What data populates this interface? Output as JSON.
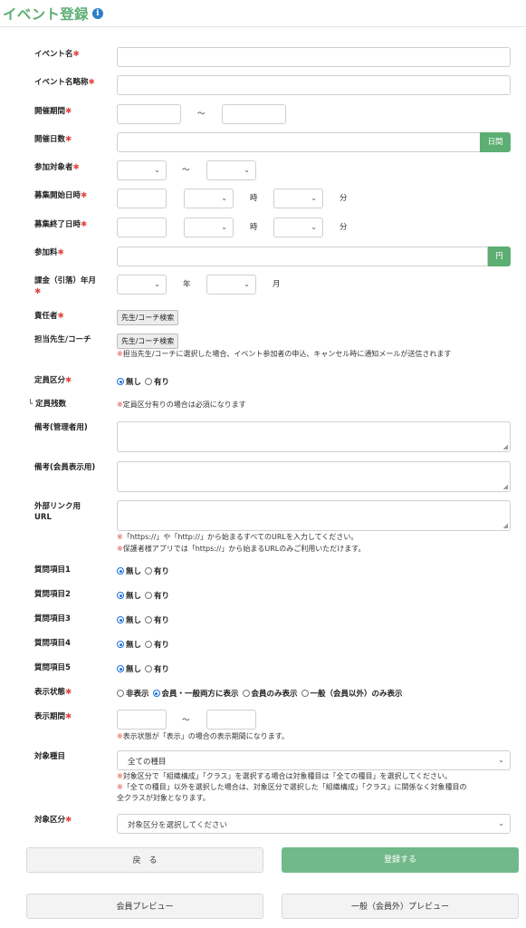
{
  "header": {
    "title": "イベント登録",
    "info_icon": "i"
  },
  "required_mark": "✱",
  "fields": {
    "event_name": "イベント名",
    "event_short": "イベント名略称",
    "period": "開催期間",
    "days": "開催日数",
    "target": "参加対象者",
    "recruit_start": "募集開始日時",
    "recruit_end": "募集終了日時",
    "fee": "参加料",
    "billing": "課金（引落）年月",
    "responsible": "責任者",
    "coach": "担当先生/コーチ",
    "capacity_type": "定員区分",
    "capacity_left": "└ 定員残数",
    "note_admin": "備考(管理者用)",
    "note_member": "備考(会員表示用)",
    "ext_link_1": "外部リンク用",
    "ext_link_2": "URL",
    "q1": "質問項目1",
    "q2": "質問項目2",
    "q3": "質問項目3",
    "q4": "質問項目4",
    "q5": "質問項目5",
    "display_state": "表示状態",
    "display_period": "表示期間",
    "target_type": "対象種目",
    "target_class": "対象区分"
  },
  "units": {
    "tilde": "〜",
    "days_addon": "日間",
    "yen_addon": "円",
    "hour": "時",
    "minute": "分",
    "year": "年",
    "month": "月"
  },
  "buttons": {
    "coach_search_1": "先生/コーチ検索",
    "coach_search_2": "先生/コーチ検索",
    "back": "戻　る",
    "register": "登録する",
    "member_preview": "会員プレビュー",
    "public_preview": "一般（会員外）プレビュー"
  },
  "notes": {
    "coach": "担当先生/コーチに選択した場合、イベント参加者の申込、キャンセル時に通知メールが送信されます",
    "capacity": "定員区分有りの場合は必須になります",
    "url_1": "「https://」や「http://」から始まるすべてのURLを入力してください。",
    "url_2": "保護者様アプリでは「https://」から始まるURLのみご利用いただけます。",
    "display_period": "表示状態が「表示」の場合の表示期間になります。",
    "type_1": "対象区分で「組織構成」「クラス」を選択する場合は対象種目は「全ての種目」を選択してください。",
    "type_2a": "「全ての種目」以外を選択した場合は、対象区分で選択した「組織構成」「クラス」に関係なく対象種目の",
    "type_2b": "全クラスが対象となります。"
  },
  "radio": {
    "none": "無し",
    "yes": "有り",
    "hide": "非表示",
    "both": "会員・一般両方に表示",
    "member_only": "会員のみ表示",
    "public_only": "一般（会員以外）のみ表示"
  },
  "selects": {
    "target_type_value": "全ての種目",
    "target_class_placeholder": "対象区分を選択してください"
  }
}
